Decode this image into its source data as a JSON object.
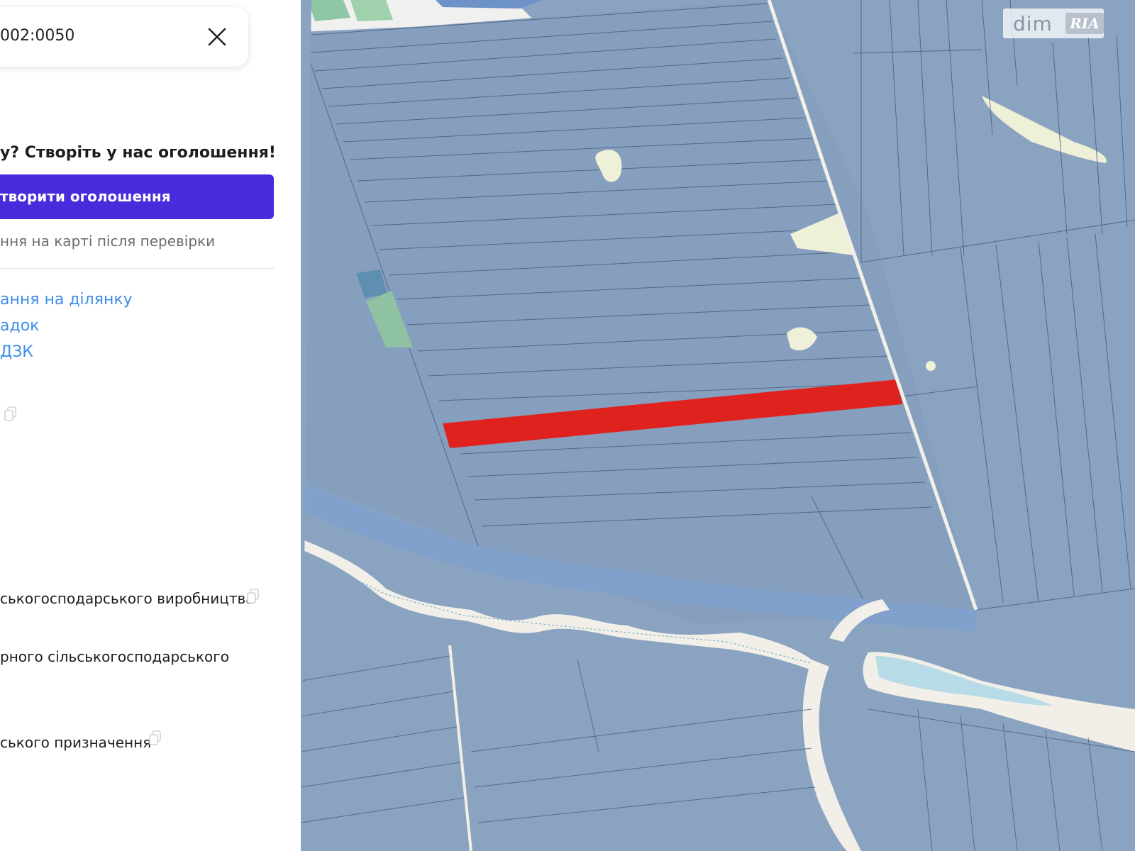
{
  "search": {
    "value": "002:0050"
  },
  "promo": {
    "title": "у? Створіть у нас оголошення!",
    "button_label": "творити оголошення",
    "note": "ння на карті після перевірки"
  },
  "links": [
    {
      "label": "ання на ділянку"
    },
    {
      "label": "адок"
    },
    {
      "label": "ДЗК"
    }
  ],
  "info": {
    "purpose_1": "ськогосподарського виробництва",
    "purpose_2": "рного сільськогосподарського",
    "purpose_3": "ського призначення"
  },
  "map": {
    "logo_left": "dim",
    "logo_right": "RIA",
    "colors": {
      "parcel_fill": "#8aa3c1",
      "selected_parcel": "#e0221f",
      "road": "#f2efe8",
      "forest": "#b5d8b3",
      "water": "#b8dbe8",
      "primary_button": "#4a2bdc",
      "link": "#3f8ee8"
    },
    "icons": [
      "close-icon",
      "copy-icon"
    ]
  }
}
